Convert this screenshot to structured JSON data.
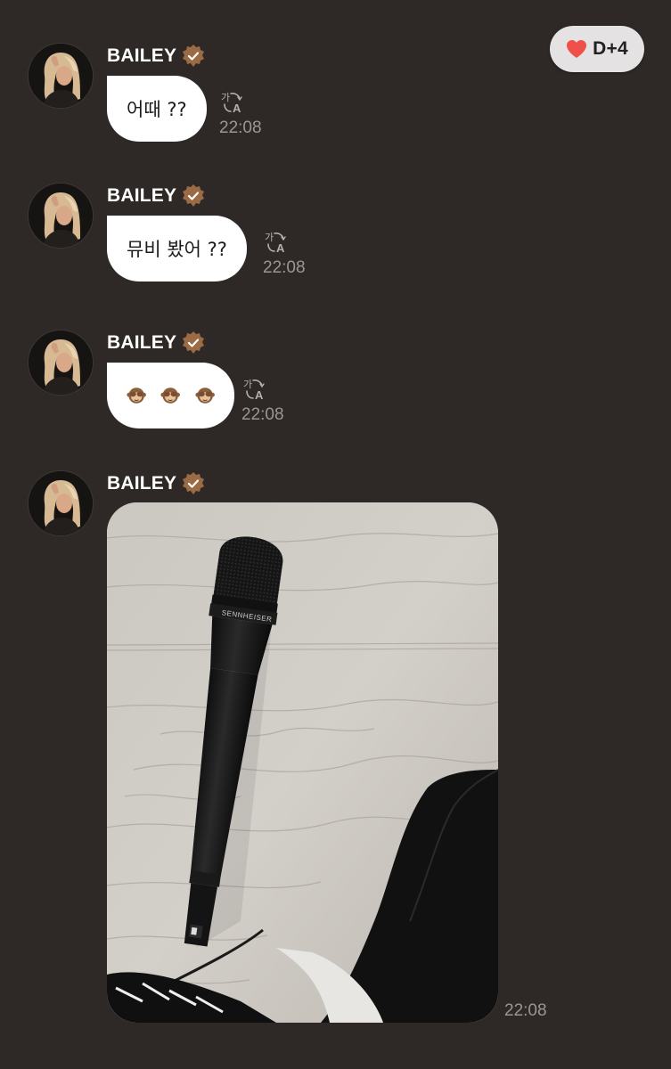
{
  "header": {
    "dday_label": "D+4",
    "heart_icon": "heart-icon",
    "heart_color": "#f0504a"
  },
  "colors": {
    "background": "#2e2926",
    "bubble": "#ffffff",
    "timestamp": "#9b9693",
    "verified_badge": "#9a6b45"
  },
  "messages": [
    {
      "sender": "BAILEY",
      "type": "text",
      "text": "어때 ??",
      "time": "22:08",
      "translate_icon": "translate-icon"
    },
    {
      "sender": "BAILEY",
      "type": "text",
      "text": "뮤비 봤어 ??",
      "time": "22:08",
      "translate_icon": "translate-icon"
    },
    {
      "sender": "BAILEY",
      "type": "emoji",
      "emoji": [
        "see-no-evil-monkey",
        "see-no-evil-monkey",
        "see-no-evil-monkey"
      ],
      "time": "22:08",
      "translate_icon": "translate-icon"
    },
    {
      "sender": "BAILEY",
      "type": "photo",
      "photo_subject": "microphone-on-wood-floor",
      "microphone_brand": "SENNHEISER",
      "time": "22:08"
    }
  ]
}
